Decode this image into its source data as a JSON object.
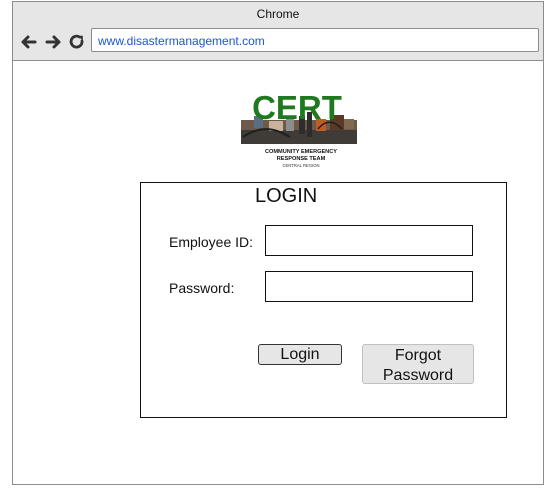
{
  "browser": {
    "title": "Chrome",
    "url": "www.disastermanagement.com",
    "back_icon": "back-arrow-icon",
    "forward_icon": "forward-arrow-icon",
    "reload_icon": "reload-icon"
  },
  "logo": {
    "wordmark": "CERT",
    "line1": "COMMUNITY EMERGENCY",
    "line2": "RESPONSE TEAM",
    "line3": "CENTRAL REGION"
  },
  "login": {
    "title": "LOGIN",
    "employee_id_label": "Employee ID:",
    "employee_id_value": "",
    "password_label": "Password:",
    "password_value": "",
    "login_button": "Login",
    "forgot_line1": "Forgot",
    "forgot_line2": "Password"
  },
  "colors": {
    "url": "#1a57d1",
    "logo_green": "#1f7a1f",
    "chrome_bg": "#e6e6e6"
  }
}
